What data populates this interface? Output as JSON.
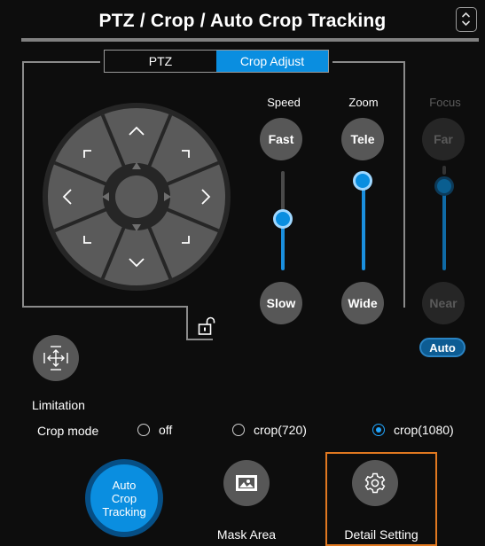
{
  "header": {
    "title": "PTZ / Crop / Auto Crop Tracking"
  },
  "tabs": [
    {
      "label": "PTZ",
      "active": false
    },
    {
      "label": "Crop Adjust",
      "active": true
    }
  ],
  "speed": {
    "label": "Speed",
    "fast_label": "Fast",
    "slow_label": "Slow",
    "level": 0.5
  },
  "zoom": {
    "label": "Zoom",
    "tele_label": "Tele",
    "wide_label": "Wide",
    "level": 1.0
  },
  "focus": {
    "label": "Focus",
    "far_label": "Far",
    "near_label": "Near",
    "auto_label": "Auto",
    "level": 1.0,
    "enabled": false
  },
  "limitation": {
    "label": "Limitation"
  },
  "crop_mode": {
    "label": "Crop mode",
    "options": [
      "off",
      "crop(720)",
      "crop(1080)"
    ],
    "selected": "crop(1080)"
  },
  "actions": {
    "auto_crop_tracking_label": "Auto\nCrop\nTracking",
    "mask_area_label": "Mask Area",
    "detail_setting_label": "Detail Setting"
  },
  "colors": {
    "accent": "#0a8ee0",
    "highlight": "#e07820",
    "button": "#575757"
  }
}
